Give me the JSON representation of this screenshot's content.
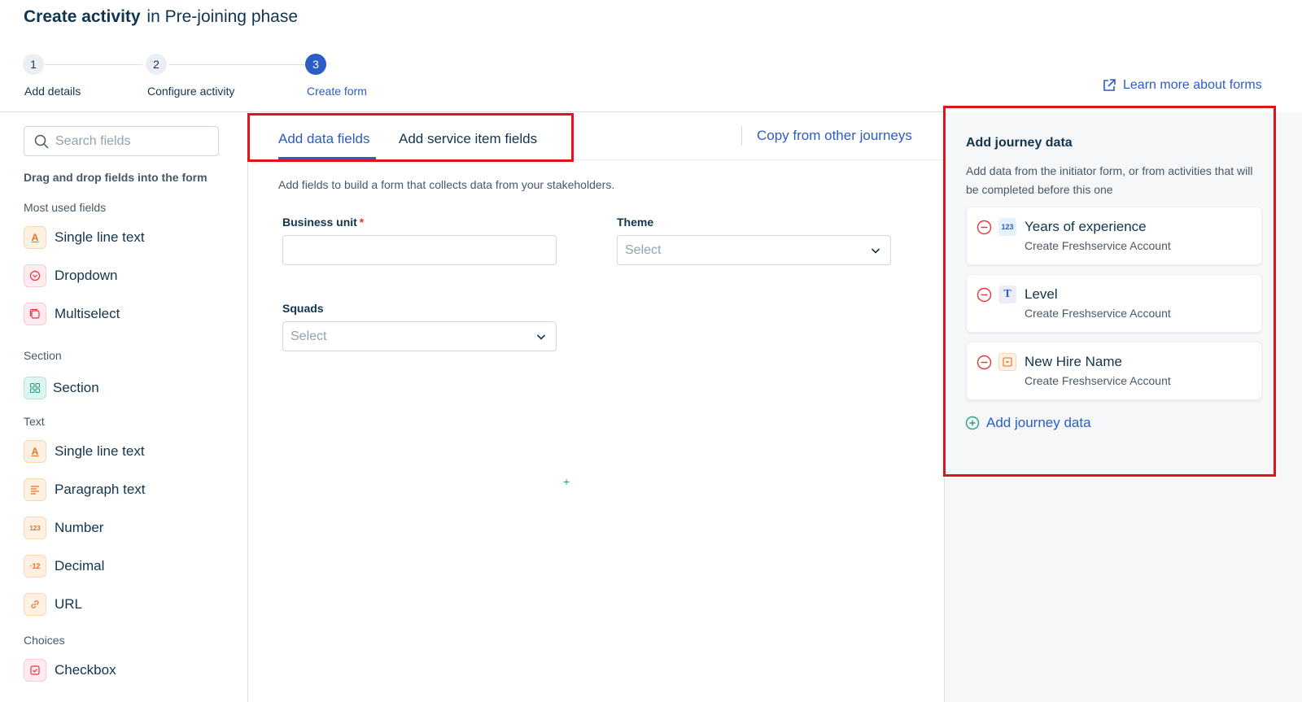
{
  "header": {
    "title_bold": "Create activity",
    "title_rest": "in Pre-joining phase",
    "learn_more": "Learn more about forms"
  },
  "steps": [
    {
      "number": "1",
      "label": "Add details"
    },
    {
      "number": "2",
      "label": "Configure activity"
    },
    {
      "number": "3",
      "label": "Create form",
      "active": true
    }
  ],
  "sidebar": {
    "search_placeholder": "Search fields",
    "hint": "Drag and drop fields into the form",
    "groups": {
      "most_used": "Most used fields",
      "section": "Section",
      "text": "Text",
      "choices": "Choices"
    },
    "items": {
      "single_line_1": "Single line text",
      "dropdown": "Dropdown",
      "multiselect": "Multiselect",
      "section": "Section",
      "single_line_2": "Single line text",
      "paragraph": "Paragraph text",
      "number": "Number",
      "decimal": "Decimal",
      "url": "URL",
      "checkbox": "Checkbox"
    },
    "icon_glyphs": {
      "text": "A",
      "number": "123",
      "decimal": "·12"
    }
  },
  "main": {
    "tabs": [
      "Add data fields",
      "Add service item fields"
    ],
    "active_tab": "Add data fields",
    "copy_link": "Copy from other journeys",
    "hint": "Add fields to build a form that collects data from your stakeholders.",
    "fields": {
      "business_unit": {
        "label": "Business unit",
        "required": "*",
        "value": ""
      },
      "theme": {
        "label": "Theme",
        "placeholder": "Select"
      },
      "squads": {
        "label": "Squads",
        "placeholder": "Select"
      }
    },
    "drop_marker": "+"
  },
  "journey_panel": {
    "title": "Add journey data",
    "description": "Add data from the initiator form, or from activities that will be completed before this one",
    "items": [
      {
        "name": "Years of experience",
        "source": "Create Freshservice Account",
        "type_icon": "number-icon",
        "glyph": "123"
      },
      {
        "name": "Level",
        "source": "Create Freshservice Account",
        "type_icon": "text-type-icon",
        "glyph": "T"
      },
      {
        "name": "New Hire Name",
        "source": "Create Freshservice Account",
        "type_icon": "dropdown-type-icon",
        "glyph": ""
      }
    ],
    "add_label": "Add journey data"
  },
  "colors": {
    "accent": "#2c5cc5",
    "highlight_border": "#e0141e",
    "text": "#12344d",
    "panel_bg": "#f5f7f9"
  }
}
